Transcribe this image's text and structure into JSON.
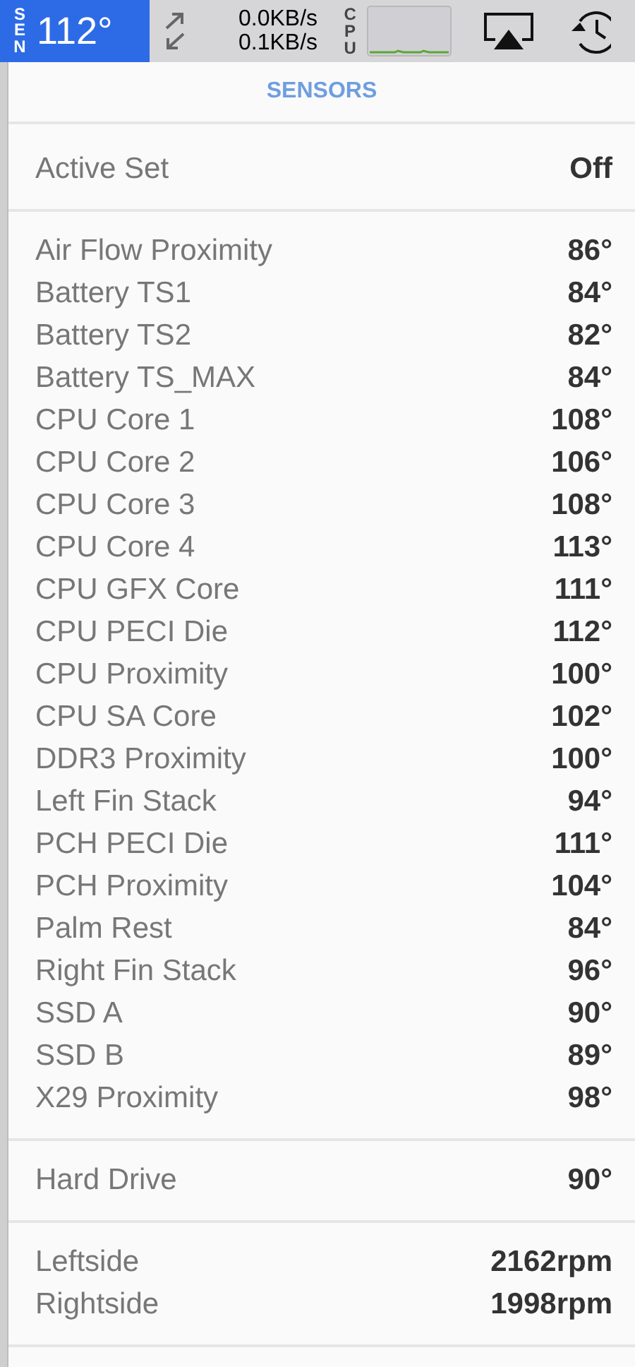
{
  "menu_bar": {
    "sen_label": "SEN",
    "temperature": "112°",
    "net_up": "0.0KB/s",
    "net_down": "0.1KB/s",
    "cpu_label": "CPU"
  },
  "title": "SENSORS",
  "sections": [
    [
      {
        "label": "Active Set",
        "value": "Off"
      }
    ],
    [
      {
        "label": "Air Flow Proximity",
        "value": "86°"
      },
      {
        "label": "Battery TS1",
        "value": "84°"
      },
      {
        "label": "Battery TS2",
        "value": "82°"
      },
      {
        "label": "Battery TS_MAX",
        "value": "84°"
      },
      {
        "label": "CPU Core 1",
        "value": "108°"
      },
      {
        "label": "CPU Core 2",
        "value": "106°"
      },
      {
        "label": "CPU Core 3",
        "value": "108°"
      },
      {
        "label": "CPU Core 4",
        "value": "113°"
      },
      {
        "label": "CPU GFX Core",
        "value": "111°"
      },
      {
        "label": "CPU PECI Die",
        "value": "112°"
      },
      {
        "label": "CPU Proximity",
        "value": "100°"
      },
      {
        "label": "CPU SA Core",
        "value": "102°"
      },
      {
        "label": "DDR3 Proximity",
        "value": "100°"
      },
      {
        "label": "Left Fin Stack",
        "value": "94°"
      },
      {
        "label": "PCH PECI Die",
        "value": "111°"
      },
      {
        "label": "PCH Proximity",
        "value": "104°"
      },
      {
        "label": "Palm Rest",
        "value": "84°"
      },
      {
        "label": "Right Fin Stack",
        "value": "96°"
      },
      {
        "label": "SSD A",
        "value": "90°"
      },
      {
        "label": "SSD B",
        "value": "89°"
      },
      {
        "label": "X29 Proximity",
        "value": "98°"
      }
    ],
    [
      {
        "label": "Hard Drive",
        "value": "90°"
      }
    ],
    [
      {
        "label": "Leftside",
        "value": "2162rpm"
      },
      {
        "label": "Rightside",
        "value": "1998rpm"
      }
    ]
  ]
}
